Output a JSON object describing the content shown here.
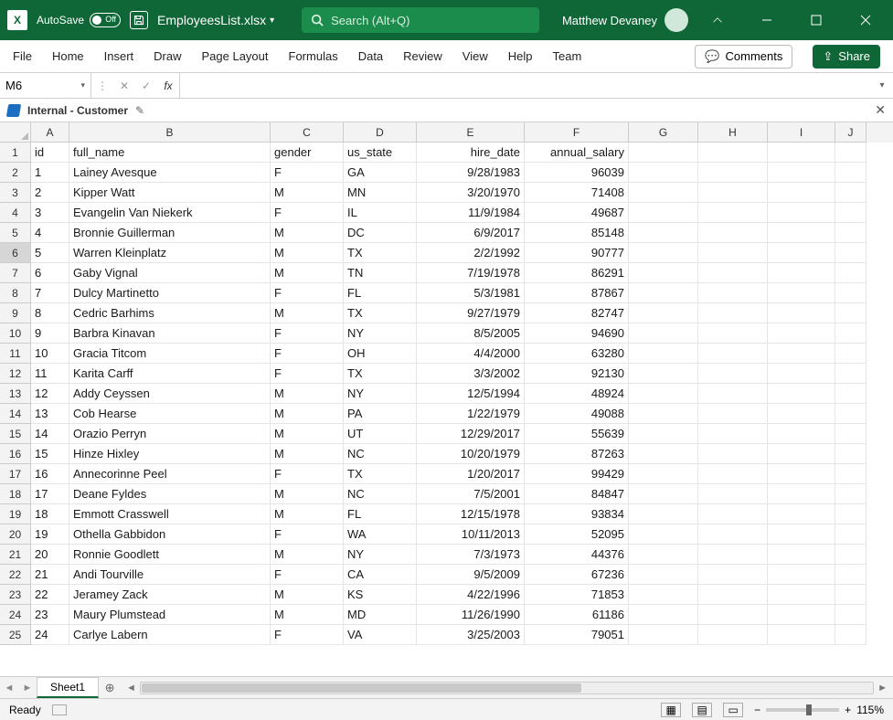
{
  "title": {
    "autosave_label": "AutoSave",
    "toggle_text": "Off",
    "filename": "EmployeesList.xlsx",
    "filename_suffix": "▾",
    "search_placeholder": "Search (Alt+Q)",
    "username": "Matthew Devaney"
  },
  "ribbon": {
    "tabs": [
      "File",
      "Home",
      "Insert",
      "Draw",
      "Page Layout",
      "Formulas",
      "Data",
      "Review",
      "View",
      "Help",
      "Team"
    ],
    "comments_label": "Comments",
    "share_label": "Share"
  },
  "namebox": {
    "ref": "M6"
  },
  "sensitivity": {
    "label": "Internal - Customer"
  },
  "columns": [
    "A",
    "B",
    "C",
    "D",
    "E",
    "F",
    "G",
    "H",
    "I",
    "J"
  ],
  "headers": {
    "A": "id",
    "B": "full_name",
    "C": "gender",
    "D": "us_state",
    "E": "hire_date",
    "F": "annual_salary"
  },
  "data_rows": [
    {
      "id": "1",
      "name": "Lainey Avesque",
      "gender": "F",
      "state": "GA",
      "hire": "9/28/1983",
      "salary": "96039"
    },
    {
      "id": "2",
      "name": "Kipper Watt",
      "gender": "M",
      "state": "MN",
      "hire": "3/20/1970",
      "salary": "71408"
    },
    {
      "id": "3",
      "name": "Evangelin Van Niekerk",
      "gender": "F",
      "state": "IL",
      "hire": "11/9/1984",
      "salary": "49687"
    },
    {
      "id": "4",
      "name": "Bronnie Guillerman",
      "gender": "M",
      "state": "DC",
      "hire": "6/9/2017",
      "salary": "85148"
    },
    {
      "id": "5",
      "name": "Warren Kleinplatz",
      "gender": "M",
      "state": "TX",
      "hire": "2/2/1992",
      "salary": "90777"
    },
    {
      "id": "6",
      "name": "Gaby Vignal",
      "gender": "M",
      "state": "TN",
      "hire": "7/19/1978",
      "salary": "86291"
    },
    {
      "id": "7",
      "name": "Dulcy Martinetto",
      "gender": "F",
      "state": "FL",
      "hire": "5/3/1981",
      "salary": "87867"
    },
    {
      "id": "8",
      "name": "Cedric Barhims",
      "gender": "M",
      "state": "TX",
      "hire": "9/27/1979",
      "salary": "82747"
    },
    {
      "id": "9",
      "name": "Barbra Kinavan",
      "gender": "F",
      "state": "NY",
      "hire": "8/5/2005",
      "salary": "94690"
    },
    {
      "id": "10",
      "name": "Gracia Titcom",
      "gender": "F",
      "state": "OH",
      "hire": "4/4/2000",
      "salary": "63280"
    },
    {
      "id": "11",
      "name": "Karita Carff",
      "gender": "F",
      "state": "TX",
      "hire": "3/3/2002",
      "salary": "92130"
    },
    {
      "id": "12",
      "name": "Addy Ceyssen",
      "gender": "M",
      "state": "NY",
      "hire": "12/5/1994",
      "salary": "48924"
    },
    {
      "id": "13",
      "name": "Cob Hearse",
      "gender": "M",
      "state": "PA",
      "hire": "1/22/1979",
      "salary": "49088"
    },
    {
      "id": "14",
      "name": "Orazio Perryn",
      "gender": "M",
      "state": "UT",
      "hire": "12/29/2017",
      "salary": "55639"
    },
    {
      "id": "15",
      "name": "Hinze Hixley",
      "gender": "M",
      "state": "NC",
      "hire": "10/20/1979",
      "salary": "87263"
    },
    {
      "id": "16",
      "name": "Annecorinne Peel",
      "gender": "F",
      "state": "TX",
      "hire": "1/20/2017",
      "salary": "99429"
    },
    {
      "id": "17",
      "name": "Deane Fyldes",
      "gender": "M",
      "state": "NC",
      "hire": "7/5/2001",
      "salary": "84847"
    },
    {
      "id": "18",
      "name": "Emmott Crasswell",
      "gender": "M",
      "state": "FL",
      "hire": "12/15/1978",
      "salary": "93834"
    },
    {
      "id": "19",
      "name": "Othella Gabbidon",
      "gender": "F",
      "state": "WA",
      "hire": "10/11/2013",
      "salary": "52095"
    },
    {
      "id": "20",
      "name": "Ronnie Goodlett",
      "gender": "M",
      "state": "NY",
      "hire": "7/3/1973",
      "salary": "44376"
    },
    {
      "id": "21",
      "name": "Andi Tourville",
      "gender": "F",
      "state": "CA",
      "hire": "9/5/2009",
      "salary": "67236"
    },
    {
      "id": "22",
      "name": "Jeramey Zack",
      "gender": "M",
      "state": "KS",
      "hire": "4/22/1996",
      "salary": "71853"
    },
    {
      "id": "23",
      "name": "Maury Plumstead",
      "gender": "M",
      "state": "MD",
      "hire": "11/26/1990",
      "salary": "61186"
    },
    {
      "id": "24",
      "name": "Carlye Labern",
      "gender": "F",
      "state": "VA",
      "hire": "3/25/2003",
      "salary": "79051"
    }
  ],
  "selected_rowhdr": 6,
  "sheet": {
    "name": "Sheet1"
  },
  "status": {
    "ready": "Ready",
    "zoom": "115%"
  }
}
